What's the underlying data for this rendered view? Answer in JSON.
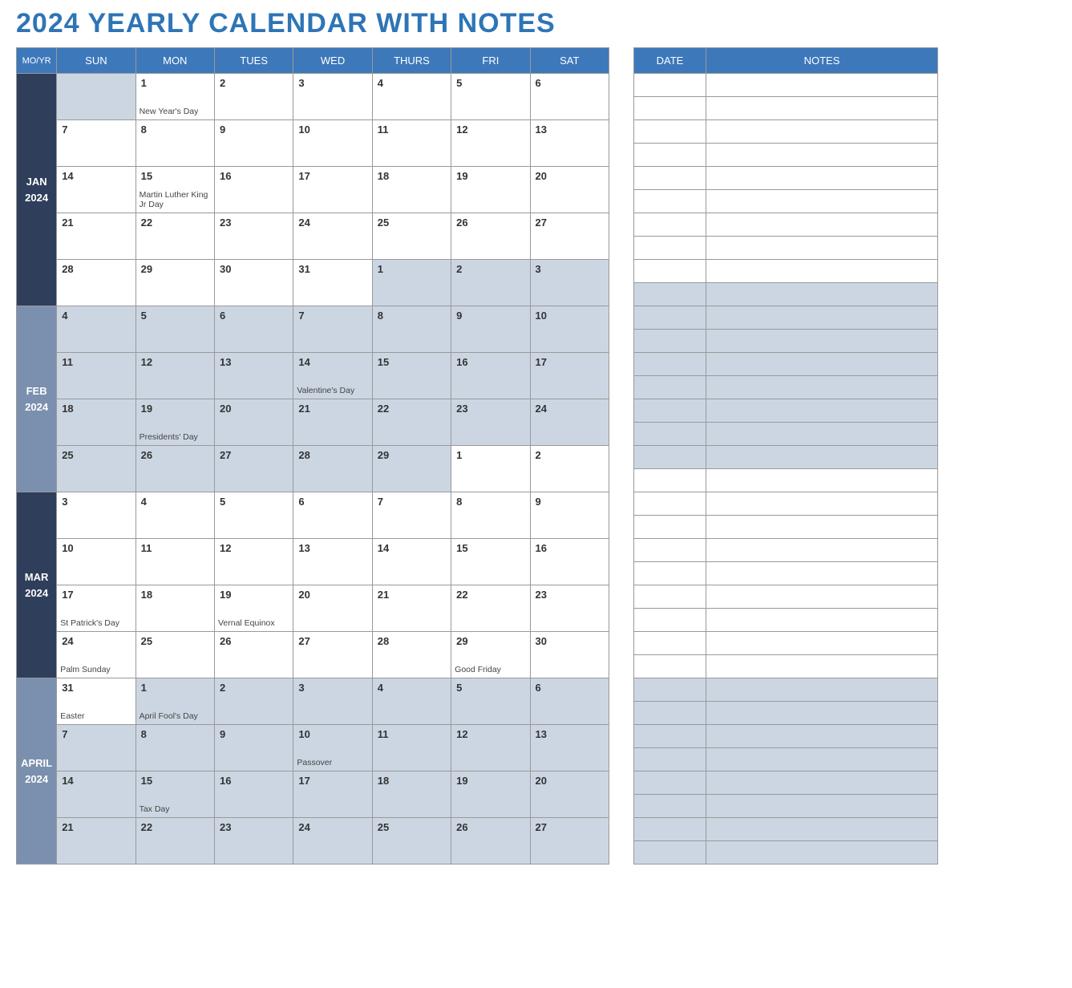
{
  "title": "2024 YEARLY CALENDAR WITH NOTES",
  "headers": {
    "moyr": "MO/YR",
    "days": [
      "SUN",
      "MON",
      "TUES",
      "WED",
      "THURS",
      "FRI",
      "SAT"
    ],
    "date": "DATE",
    "notes": "NOTES"
  },
  "months": [
    {
      "label_top": "JAN",
      "label_bottom": "2024",
      "tone": "dark",
      "rows": [
        [
          {
            "n": "",
            "ev": "",
            "s": true
          },
          {
            "n": "1",
            "ev": "New Year's Day",
            "s": false
          },
          {
            "n": "2",
            "ev": "",
            "s": false
          },
          {
            "n": "3",
            "ev": "",
            "s": false
          },
          {
            "n": "4",
            "ev": "",
            "s": false
          },
          {
            "n": "5",
            "ev": "",
            "s": false
          },
          {
            "n": "6",
            "ev": "",
            "s": false
          }
        ],
        [
          {
            "n": "7",
            "ev": "",
            "s": false
          },
          {
            "n": "8",
            "ev": "",
            "s": false
          },
          {
            "n": "9",
            "ev": "",
            "s": false
          },
          {
            "n": "10",
            "ev": "",
            "s": false
          },
          {
            "n": "11",
            "ev": "",
            "s": false
          },
          {
            "n": "12",
            "ev": "",
            "s": false
          },
          {
            "n": "13",
            "ev": "",
            "s": false
          }
        ],
        [
          {
            "n": "14",
            "ev": "",
            "s": false
          },
          {
            "n": "15",
            "ev": "Martin Luther King Jr Day",
            "s": false
          },
          {
            "n": "16",
            "ev": "",
            "s": false
          },
          {
            "n": "17",
            "ev": "",
            "s": false
          },
          {
            "n": "18",
            "ev": "",
            "s": false
          },
          {
            "n": "19",
            "ev": "",
            "s": false
          },
          {
            "n": "20",
            "ev": "",
            "s": false
          }
        ],
        [
          {
            "n": "21",
            "ev": "",
            "s": false
          },
          {
            "n": "22",
            "ev": "",
            "s": false
          },
          {
            "n": "23",
            "ev": "",
            "s": false
          },
          {
            "n": "24",
            "ev": "",
            "s": false
          },
          {
            "n": "25",
            "ev": "",
            "s": false
          },
          {
            "n": "26",
            "ev": "",
            "s": false
          },
          {
            "n": "27",
            "ev": "",
            "s": false
          }
        ],
        [
          {
            "n": "28",
            "ev": "",
            "s": false
          },
          {
            "n": "29",
            "ev": "",
            "s": false
          },
          {
            "n": "30",
            "ev": "",
            "s": false
          },
          {
            "n": "31",
            "ev": "",
            "s": false
          },
          {
            "n": "1",
            "ev": "",
            "s": true
          },
          {
            "n": "2",
            "ev": "",
            "s": true
          },
          {
            "n": "3",
            "ev": "",
            "s": true
          }
        ]
      ]
    },
    {
      "label_top": "FEB",
      "label_bottom": "2024",
      "tone": "light",
      "rows": [
        [
          {
            "n": "4",
            "ev": "",
            "s": true
          },
          {
            "n": "5",
            "ev": "",
            "s": true
          },
          {
            "n": "6",
            "ev": "",
            "s": true
          },
          {
            "n": "7",
            "ev": "",
            "s": true
          },
          {
            "n": "8",
            "ev": "",
            "s": true
          },
          {
            "n": "9",
            "ev": "",
            "s": true
          },
          {
            "n": "10",
            "ev": "",
            "s": true
          }
        ],
        [
          {
            "n": "11",
            "ev": "",
            "s": true
          },
          {
            "n": "12",
            "ev": "",
            "s": true
          },
          {
            "n": "13",
            "ev": "",
            "s": true
          },
          {
            "n": "14",
            "ev": "Valentine's Day",
            "s": true
          },
          {
            "n": "15",
            "ev": "",
            "s": true
          },
          {
            "n": "16",
            "ev": "",
            "s": true
          },
          {
            "n": "17",
            "ev": "",
            "s": true
          }
        ],
        [
          {
            "n": "18",
            "ev": "",
            "s": true
          },
          {
            "n": "19",
            "ev": "Presidents' Day",
            "s": true
          },
          {
            "n": "20",
            "ev": "",
            "s": true
          },
          {
            "n": "21",
            "ev": "",
            "s": true
          },
          {
            "n": "22",
            "ev": "",
            "s": true
          },
          {
            "n": "23",
            "ev": "",
            "s": true
          },
          {
            "n": "24",
            "ev": "",
            "s": true
          }
        ],
        [
          {
            "n": "25",
            "ev": "",
            "s": true
          },
          {
            "n": "26",
            "ev": "",
            "s": true
          },
          {
            "n": "27",
            "ev": "",
            "s": true
          },
          {
            "n": "28",
            "ev": "",
            "s": true
          },
          {
            "n": "29",
            "ev": "",
            "s": true
          },
          {
            "n": "1",
            "ev": "",
            "s": false
          },
          {
            "n": "2",
            "ev": "",
            "s": false
          }
        ]
      ]
    },
    {
      "label_top": "MAR",
      "label_bottom": "2024",
      "tone": "dark",
      "rows": [
        [
          {
            "n": "3",
            "ev": "",
            "s": false
          },
          {
            "n": "4",
            "ev": "",
            "s": false
          },
          {
            "n": "5",
            "ev": "",
            "s": false
          },
          {
            "n": "6",
            "ev": "",
            "s": false
          },
          {
            "n": "7",
            "ev": "",
            "s": false
          },
          {
            "n": "8",
            "ev": "",
            "s": false
          },
          {
            "n": "9",
            "ev": "",
            "s": false
          }
        ],
        [
          {
            "n": "10",
            "ev": "",
            "s": false
          },
          {
            "n": "11",
            "ev": "",
            "s": false
          },
          {
            "n": "12",
            "ev": "",
            "s": false
          },
          {
            "n": "13",
            "ev": "",
            "s": false
          },
          {
            "n": "14",
            "ev": "",
            "s": false
          },
          {
            "n": "15",
            "ev": "",
            "s": false
          },
          {
            "n": "16",
            "ev": "",
            "s": false
          }
        ],
        [
          {
            "n": "17",
            "ev": "St Patrick's Day",
            "s": false
          },
          {
            "n": "18",
            "ev": "",
            "s": false
          },
          {
            "n": "19",
            "ev": "Vernal Equinox",
            "s": false
          },
          {
            "n": "20",
            "ev": "",
            "s": false
          },
          {
            "n": "21",
            "ev": "",
            "s": false
          },
          {
            "n": "22",
            "ev": "",
            "s": false
          },
          {
            "n": "23",
            "ev": "",
            "s": false
          }
        ],
        [
          {
            "n": "24",
            "ev": "Palm Sunday",
            "s": false
          },
          {
            "n": "25",
            "ev": "",
            "s": false
          },
          {
            "n": "26",
            "ev": "",
            "s": false
          },
          {
            "n": "27",
            "ev": "",
            "s": false
          },
          {
            "n": "28",
            "ev": "",
            "s": false
          },
          {
            "n": "29",
            "ev": "Good Friday",
            "s": false
          },
          {
            "n": "30",
            "ev": "",
            "s": false
          }
        ]
      ]
    },
    {
      "label_top": "APRIL",
      "label_bottom": "2024",
      "tone": "light",
      "rows": [
        [
          {
            "n": "31",
            "ev": "Easter",
            "s": false
          },
          {
            "n": "1",
            "ev": "April Fool's Day",
            "s": true
          },
          {
            "n": "2",
            "ev": "",
            "s": true
          },
          {
            "n": "3",
            "ev": "",
            "s": true
          },
          {
            "n": "4",
            "ev": "",
            "s": true
          },
          {
            "n": "5",
            "ev": "",
            "s": true
          },
          {
            "n": "6",
            "ev": "",
            "s": true
          }
        ],
        [
          {
            "n": "7",
            "ev": "",
            "s": true
          },
          {
            "n": "8",
            "ev": "",
            "s": true
          },
          {
            "n": "9",
            "ev": "",
            "s": true
          },
          {
            "n": "10",
            "ev": "Passover",
            "s": true
          },
          {
            "n": "11",
            "ev": "",
            "s": true
          },
          {
            "n": "12",
            "ev": "",
            "s": true
          },
          {
            "n": "13",
            "ev": "",
            "s": true
          }
        ],
        [
          {
            "n": "14",
            "ev": "",
            "s": true
          },
          {
            "n": "15",
            "ev": "Tax Day",
            "s": true
          },
          {
            "n": "16",
            "ev": "",
            "s": true
          },
          {
            "n": "17",
            "ev": "",
            "s": true
          },
          {
            "n": "18",
            "ev": "",
            "s": true
          },
          {
            "n": "19",
            "ev": "",
            "s": true
          },
          {
            "n": "20",
            "ev": "",
            "s": true
          }
        ],
        [
          {
            "n": "21",
            "ev": "",
            "s": true
          },
          {
            "n": "22",
            "ev": "",
            "s": true
          },
          {
            "n": "23",
            "ev": "",
            "s": true
          },
          {
            "n": "24",
            "ev": "",
            "s": true
          },
          {
            "n": "25",
            "ev": "",
            "s": true
          },
          {
            "n": "26",
            "ev": "",
            "s": true
          },
          {
            "n": "27",
            "ev": "",
            "s": true
          }
        ]
      ]
    }
  ],
  "notes_rows": [
    {
      "s": false
    },
    {
      "s": false
    },
    {
      "s": false
    },
    {
      "s": false
    },
    {
      "s": false
    },
    {
      "s": false
    },
    {
      "s": false
    },
    {
      "s": false
    },
    {
      "s": false
    },
    {
      "s": true
    },
    {
      "s": true
    },
    {
      "s": true
    },
    {
      "s": true
    },
    {
      "s": true
    },
    {
      "s": true
    },
    {
      "s": true
    },
    {
      "s": true
    },
    {
      "s": false
    },
    {
      "s": false
    },
    {
      "s": false
    },
    {
      "s": false
    },
    {
      "s": false
    },
    {
      "s": false
    },
    {
      "s": false
    },
    {
      "s": false
    },
    {
      "s": false
    },
    {
      "s": true
    },
    {
      "s": true
    },
    {
      "s": true
    },
    {
      "s": true
    },
    {
      "s": true
    },
    {
      "s": true
    },
    {
      "s": true
    },
    {
      "s": true
    }
  ]
}
